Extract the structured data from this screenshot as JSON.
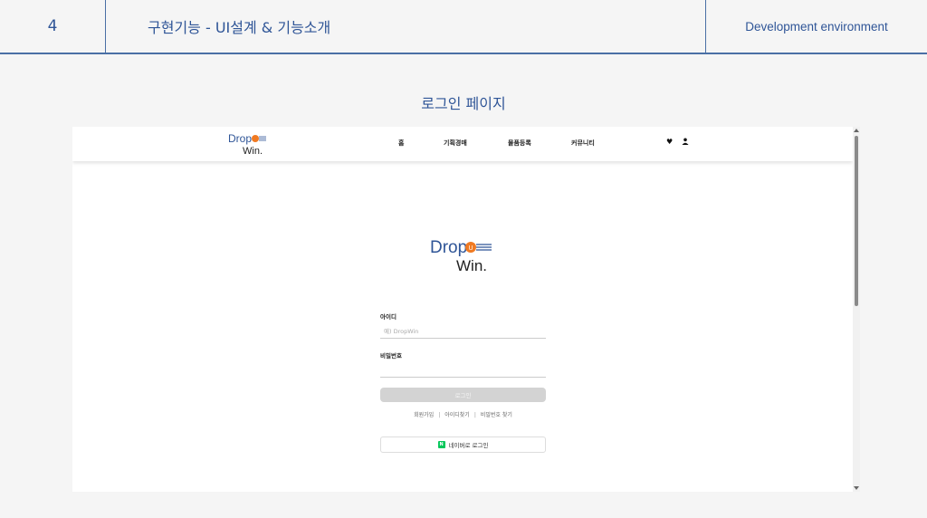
{
  "slide": {
    "number": "4",
    "title": "구현기능 - UI설계 & 기능소개",
    "right_label": "Development environment",
    "section_title": "로그인 페이지"
  },
  "brand": {
    "logo_text_top": "Drop",
    "logo_text_bottom": "Win.",
    "logo_badge": "U",
    "colors": {
      "blue": "#2f5597",
      "orange": "#f07a22",
      "naver_green": "#03c75a"
    }
  },
  "nav": {
    "items": [
      "홈",
      "기획경매",
      "물품등록",
      "커뮤니티"
    ],
    "icons": [
      "heart-icon",
      "user-icon"
    ]
  },
  "login": {
    "id_label": "아이디",
    "id_placeholder": "예) DropWin",
    "pw_label": "비밀번호",
    "pw_value": "",
    "login_button": "로그인",
    "links": [
      "회원가입",
      "아이디찾기",
      "비밀번호 찾기"
    ],
    "naver_button": "네이버로 로그인",
    "naver_badge": "N"
  }
}
